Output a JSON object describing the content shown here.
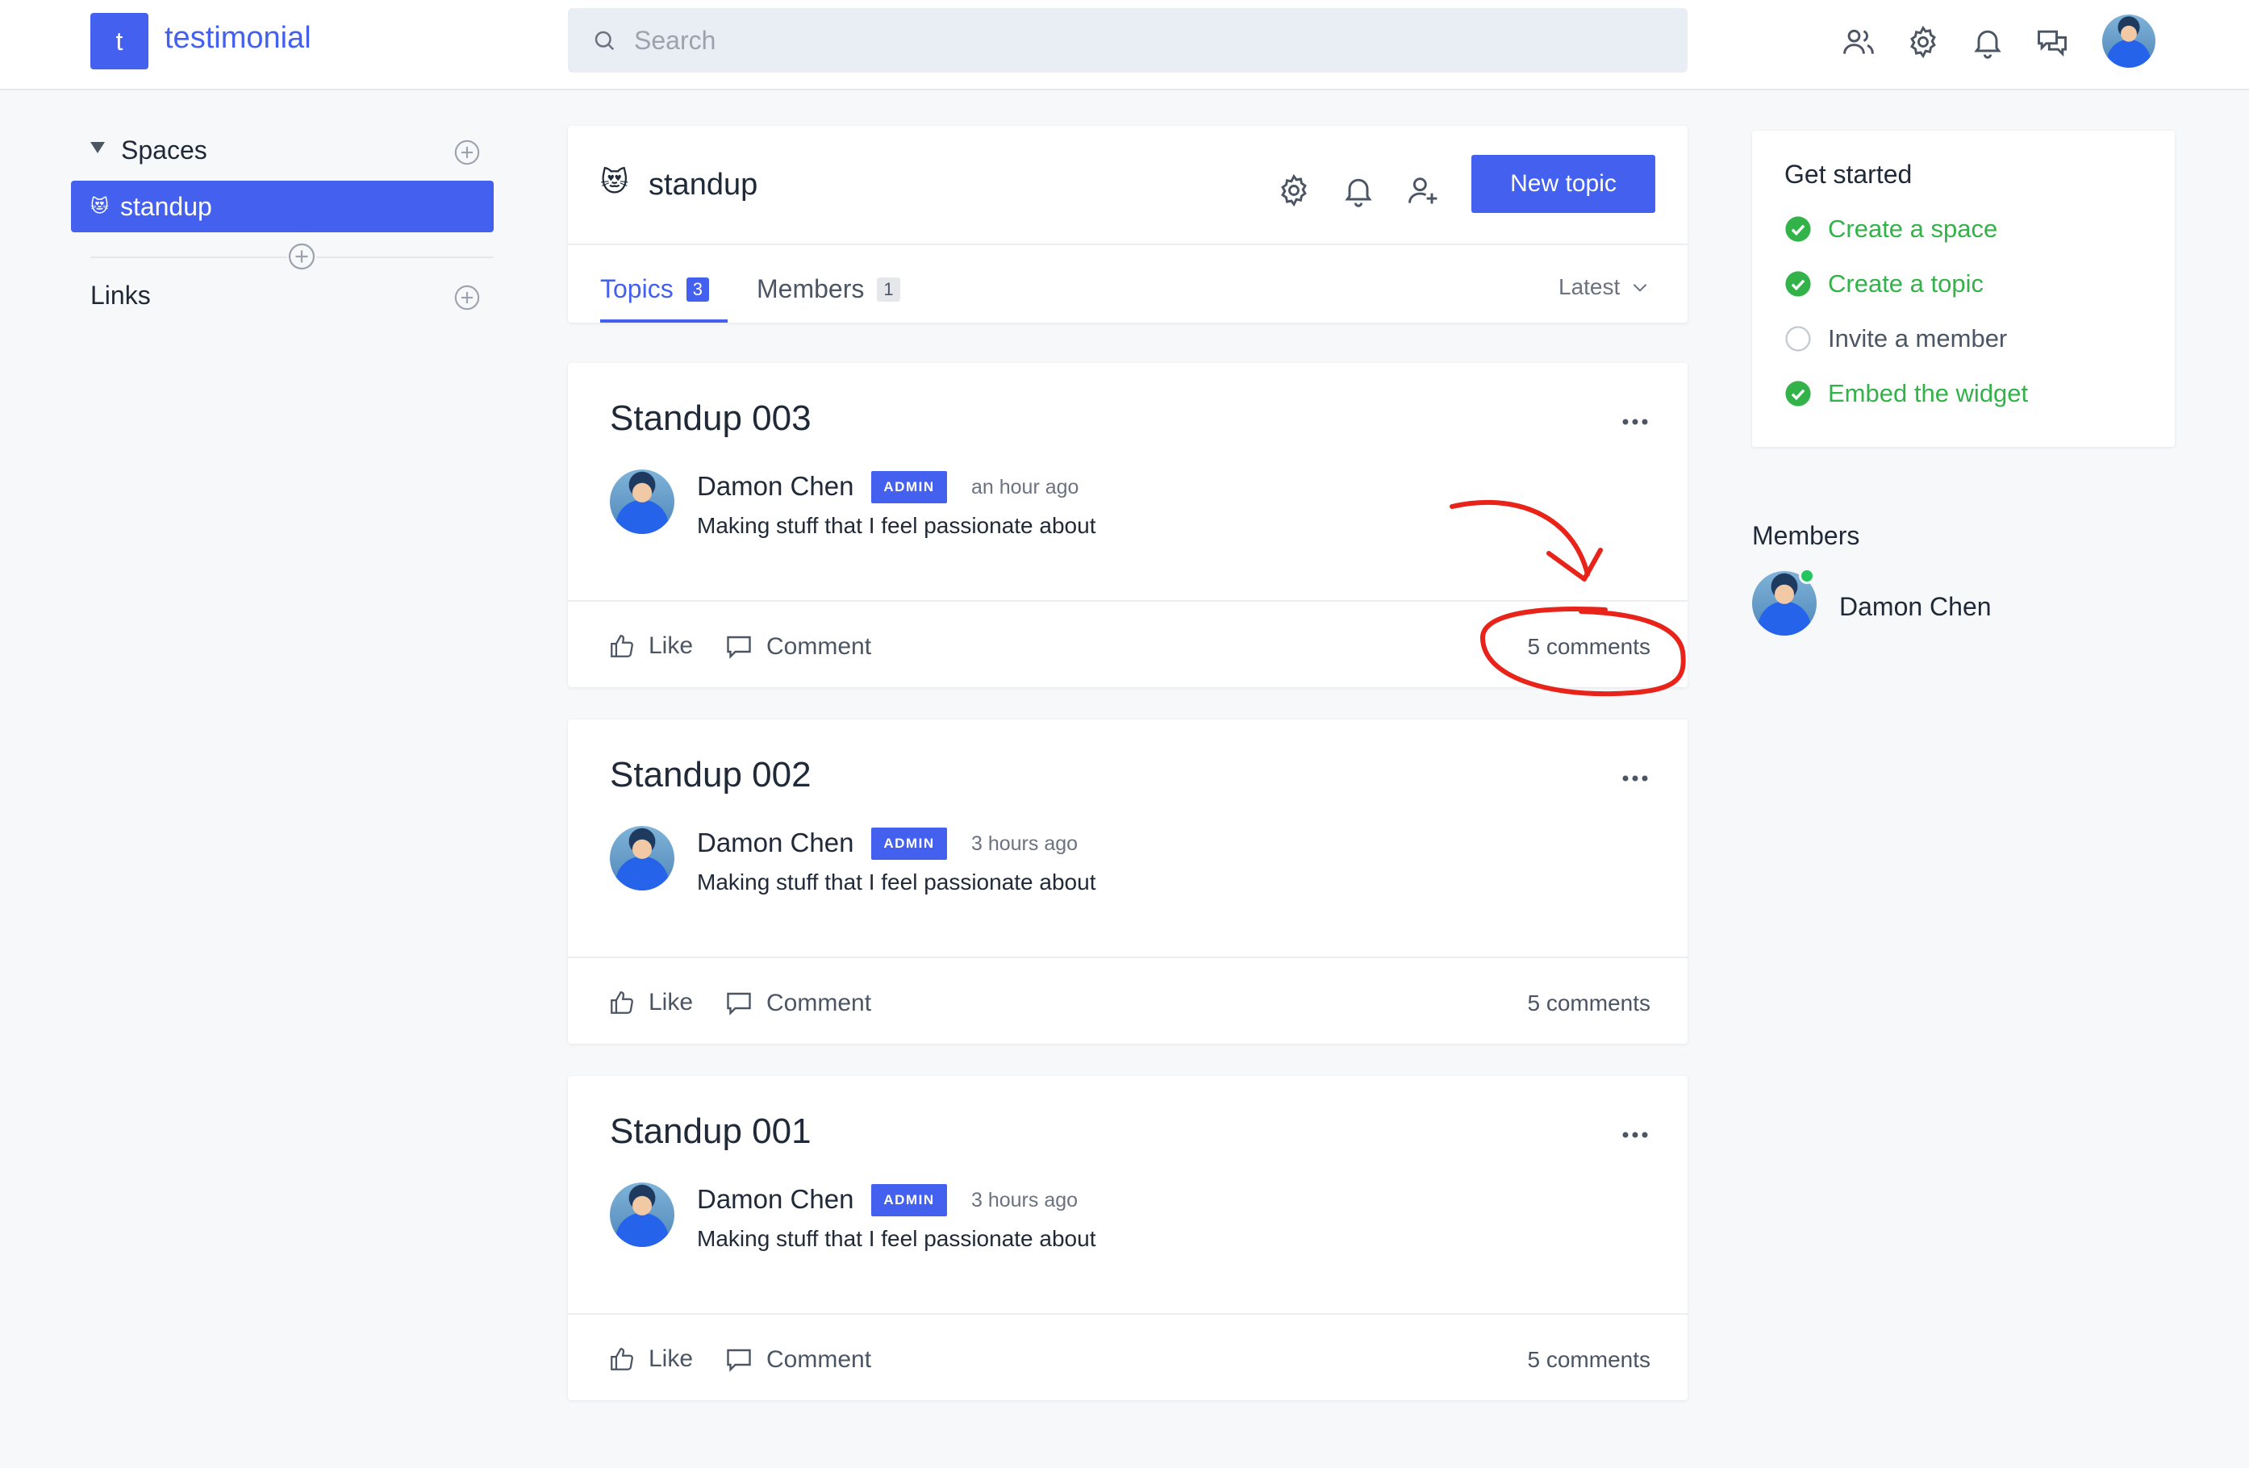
{
  "app": {
    "logo_letter": "t",
    "name": "testimonial"
  },
  "search": {
    "placeholder": "Search"
  },
  "colors": {
    "accent": "#4361ee",
    "success": "#34b24a",
    "annotation": "#e8231a"
  },
  "topbar_icons": [
    "members-icon",
    "gear-icon",
    "bell-icon",
    "chat-icon",
    "avatar"
  ],
  "sidebar": {
    "spaces_label": "Spaces",
    "active_space": {
      "emoji": "😻",
      "label": "standup"
    },
    "links_label": "Links"
  },
  "space": {
    "emoji": "😻",
    "title": "standup",
    "new_topic_label": "New topic",
    "tabs": [
      {
        "label": "Topics",
        "count": "3"
      },
      {
        "label": "Members",
        "count": "1"
      }
    ],
    "sort_label": "Latest"
  },
  "topics": [
    {
      "title": "Standup 003",
      "author": "Damon Chen",
      "role": "ADMIN",
      "time": "an hour ago",
      "bio": "Making stuff that I feel passionate about",
      "like_label": "Like",
      "comment_label": "Comment",
      "comments": "5 comments"
    },
    {
      "title": "Standup 002",
      "author": "Damon Chen",
      "role": "ADMIN",
      "time": "3 hours ago",
      "bio": "Making stuff that I feel passionate about",
      "like_label": "Like",
      "comment_label": "Comment",
      "comments": "5 comments"
    },
    {
      "title": "Standup 001",
      "author": "Damon Chen",
      "role": "ADMIN",
      "time": "3 hours ago",
      "bio": "Making stuff that I feel passionate about",
      "like_label": "Like",
      "comment_label": "Comment",
      "comments": "5 comments"
    }
  ],
  "get_started": {
    "title": "Get started",
    "items": [
      {
        "label": "Create a space",
        "done": true
      },
      {
        "label": "Create a topic",
        "done": true
      },
      {
        "label": "Invite a member",
        "done": false
      },
      {
        "label": "Embed the widget",
        "done": true
      }
    ]
  },
  "members_panel": {
    "title": "Members",
    "members": [
      {
        "name": "Damon Chen",
        "online": true
      }
    ]
  }
}
